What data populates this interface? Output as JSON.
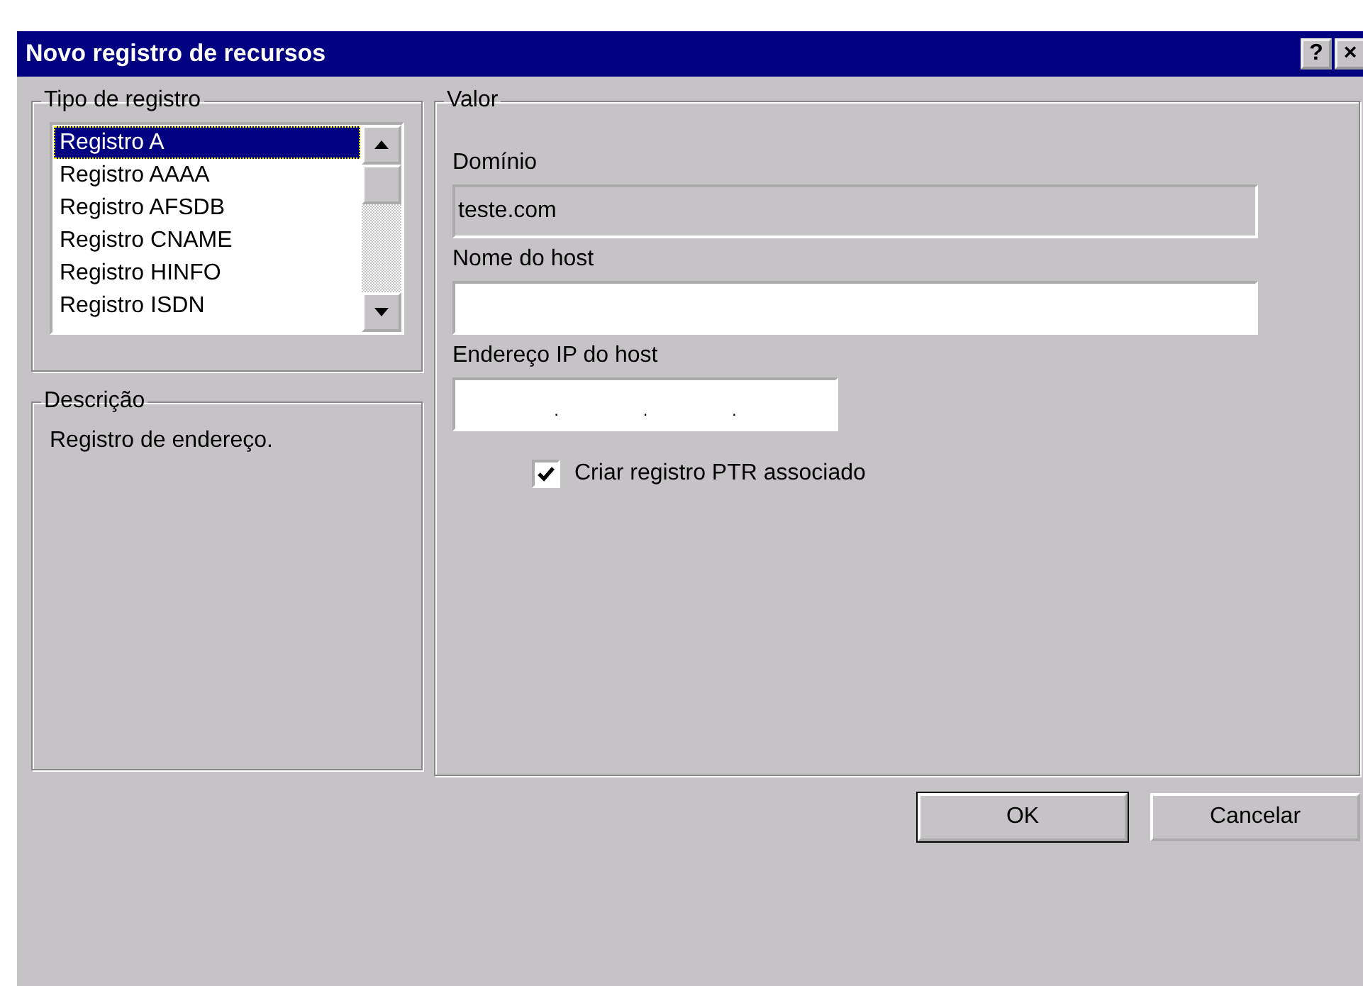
{
  "window": {
    "title": "Novo registro de recursos",
    "help_button": "?",
    "close_button": "×"
  },
  "record_type": {
    "legend": "Tipo de registro",
    "items": [
      {
        "label": "Registro A",
        "selected": true
      },
      {
        "label": "Registro AAAA",
        "selected": false
      },
      {
        "label": "Registro AFSDB",
        "selected": false
      },
      {
        "label": "Registro CNAME",
        "selected": false
      },
      {
        "label": "Registro HINFO",
        "selected": false
      },
      {
        "label": "Registro ISDN",
        "selected": false
      }
    ]
  },
  "description": {
    "legend": "Descrição",
    "text": "Registro de endereço."
  },
  "value": {
    "legend": "Valor",
    "domain": {
      "label": "Domínio",
      "value": "teste.com",
      "disabled": true
    },
    "host_name": {
      "label": "Nome do host"
    },
    "ip_address": {
      "label": "Endereço IP do host",
      "separators": [
        ".",
        ".",
        "."
      ]
    },
    "ptr": {
      "label": "Criar registro PTR associado",
      "checked": true
    }
  },
  "buttons": [
    {
      "label": "OK",
      "default": true
    },
    {
      "label": "Cancelar",
      "default": false
    }
  ]
}
